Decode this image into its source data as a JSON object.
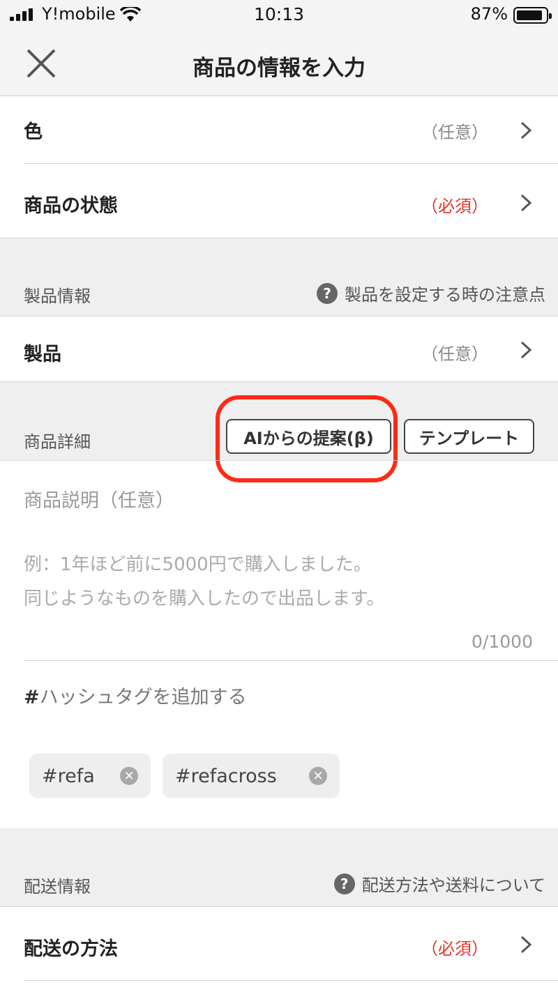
{
  "status": {
    "carrier": "Y!mobile",
    "time": "10:13",
    "battery": "87%"
  },
  "nav": {
    "title": "商品の情報を入力"
  },
  "rows": {
    "color": {
      "label": "色",
      "tag": "（任意）"
    },
    "condition": {
      "label": "商品の状態",
      "tag": "（必須）"
    },
    "product": {
      "label": "製品",
      "tag": "（任意）"
    },
    "shipping_method": {
      "label": "配送の方法",
      "tag": "（必須）"
    }
  },
  "sections": {
    "product_info": {
      "title": "製品情報",
      "help": "製品を設定する時の注意点"
    },
    "item_detail": {
      "title": "商品詳細",
      "ai_button": "AIからの提案(β)",
      "template_button": "テンプレート"
    },
    "shipping_info": {
      "title": "配送情報",
      "help": "配送方法や送料について"
    }
  },
  "description": {
    "label": "商品説明（任意）",
    "placeholder_line1": "例：1年ほど前に5000円で購入しました。",
    "placeholder_line2": "同じようなものを購入したので出品します。",
    "counter": "0/1000"
  },
  "hashtags": {
    "add_hash": "#",
    "add_label": "ハッシュタグを追加する",
    "tags": [
      "#refa",
      "#refacross"
    ]
  },
  "colors": {
    "required": "#e0352b",
    "highlight": "#ff2a14"
  },
  "icons": {
    "close": "close-icon",
    "chevron": "chevron-right-icon",
    "help": "question-circle-icon",
    "remove": "remove-tag-icon"
  }
}
